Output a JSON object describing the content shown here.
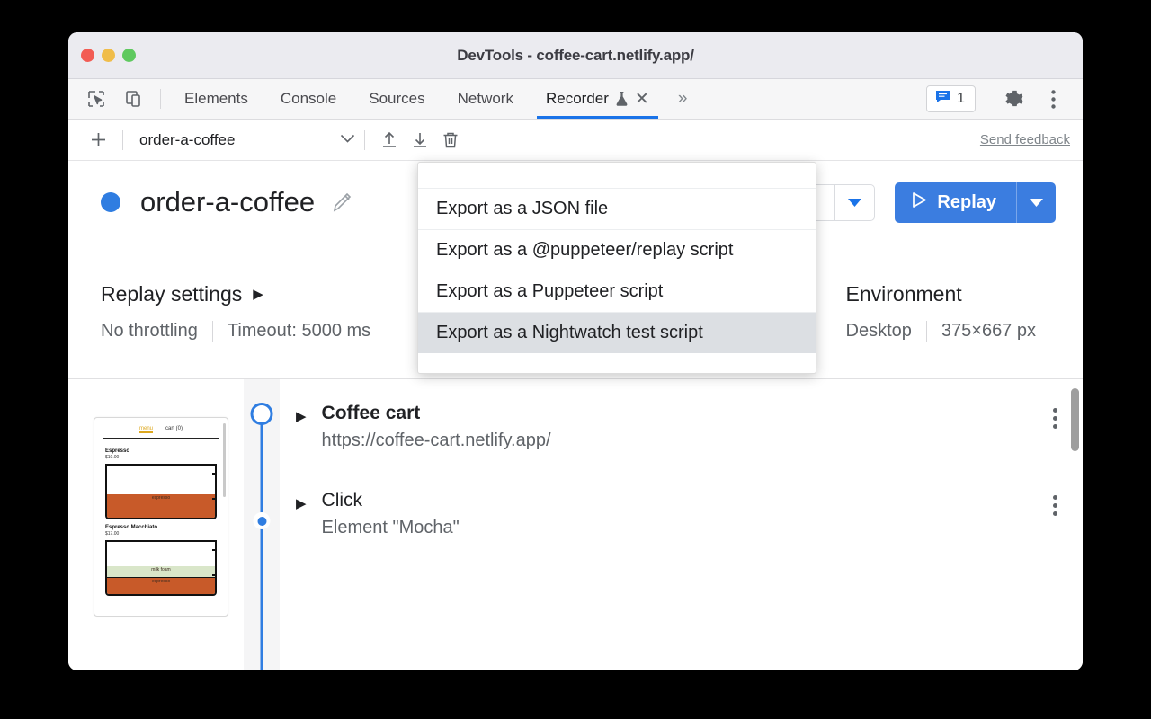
{
  "window": {
    "title": "DevTools - coffee-cart.netlify.app/",
    "traffic_lights": [
      "close-red",
      "minimize-yellow",
      "zoom-green"
    ]
  },
  "tabstrip": {
    "inspect_icon": "inspect-element-icon",
    "device_icon": "device-toolbar-icon",
    "tabs": [
      {
        "label": "Elements",
        "active": false
      },
      {
        "label": "Console",
        "active": false
      },
      {
        "label": "Sources",
        "active": false
      },
      {
        "label": "Network",
        "active": false
      },
      {
        "label": "Recorder",
        "active": true,
        "experiment_icon": "flask-icon",
        "close_icon": "close-icon"
      }
    ],
    "more_tabs_icon": "chevron-double-right-icon",
    "issues": {
      "icon": "issues-message-icon",
      "count": "1"
    },
    "settings_icon": "gear-icon",
    "more_options_icon": "kebab-menu-icon"
  },
  "recorder_toolbar": {
    "add_icon": "plus-icon",
    "recording_name": "order-a-coffee",
    "select_caret_icon": "chevron-down-icon",
    "import_icon": "import-upload-icon",
    "export_icon": "export-download-icon",
    "delete_icon": "trash-icon",
    "send_feedback": "Send feedback"
  },
  "export_menu": {
    "items": [
      {
        "label": "Export as a JSON file",
        "highlighted": false
      },
      {
        "label": "Export as a @puppeteer/replay script",
        "highlighted": false
      },
      {
        "label": "Export as a Puppeteer script",
        "highlighted": false
      },
      {
        "label": "Export as a Nightwatch test script",
        "highlighted": true
      }
    ]
  },
  "header": {
    "status_dot": "recording-status-dot",
    "title": "order-a-coffee",
    "edit_icon": "pencil-edit-icon",
    "speed_select_caret": "chevron-down-icon",
    "replay": {
      "play_icon": "play-triangle-icon",
      "label": "Replay",
      "split_caret_icon": "chevron-down-icon"
    }
  },
  "settings": {
    "replay": {
      "heading": "Replay settings",
      "expand_icon": "triangle-right-icon",
      "throttling": "No throttling",
      "timeout": "Timeout: 5000 ms"
    },
    "environment": {
      "heading": "Environment",
      "device": "Desktop",
      "viewport": "375×667 px"
    }
  },
  "steps": {
    "thumbnail": {
      "nav_menu": "menu",
      "nav_cart": "cart (0)",
      "items": [
        {
          "name": "Espresso",
          "price": "$10.00",
          "layers": [
            "espresso"
          ]
        },
        {
          "name": "Espresso Macchiato",
          "price": "$17.00",
          "layers": [
            "milk foam",
            "espresso"
          ]
        }
      ]
    },
    "list": [
      {
        "marker": "start-node",
        "expand_icon": "triangle-right-icon",
        "title": "Coffee cart",
        "subtitle": "https://coffee-cart.netlify.app/",
        "menu_icon": "kebab-menu-icon"
      },
      {
        "marker": "step-node",
        "expand_icon": "triangle-right-icon",
        "title": "Click",
        "subtitle": "Element \"Mocha\"",
        "menu_icon": "kebab-menu-icon"
      }
    ]
  },
  "colors": {
    "accent_blue": "#2f7de1",
    "replay_blue": "#3b7de0",
    "tab_underline": "#1a73e8",
    "menu_highlight": "#dcdfe3"
  }
}
